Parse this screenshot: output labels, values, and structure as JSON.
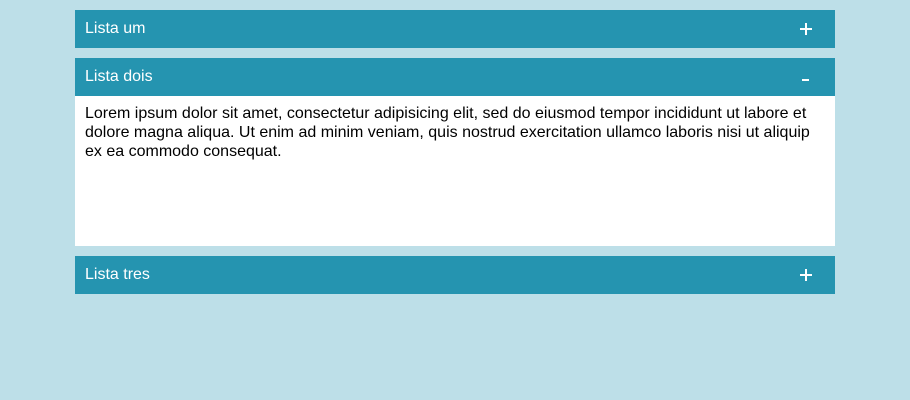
{
  "accordion": {
    "panels": [
      {
        "title": "Lista um",
        "icon": "plus-icon",
        "expanded": false
      },
      {
        "title": "Lista dois",
        "icon": "minus-icon",
        "expanded": true,
        "content": "Lorem ipsum dolor sit amet, consectetur adipisicing elit, sed do eiusmod tempor incididunt ut labore et dolore magna aliqua. Ut enim ad minim veniam, quis nostrud exercitation ullamco laboris nisi ut aliquip ex ea commodo consequat."
      },
      {
        "title": "Lista tres",
        "icon": "plus-icon",
        "expanded": false
      }
    ]
  },
  "colors": {
    "background": "#bddfe8",
    "header": "#2594b0",
    "content_bg": "#ffffff",
    "header_text": "#ffffff",
    "content_text": "#000000"
  }
}
